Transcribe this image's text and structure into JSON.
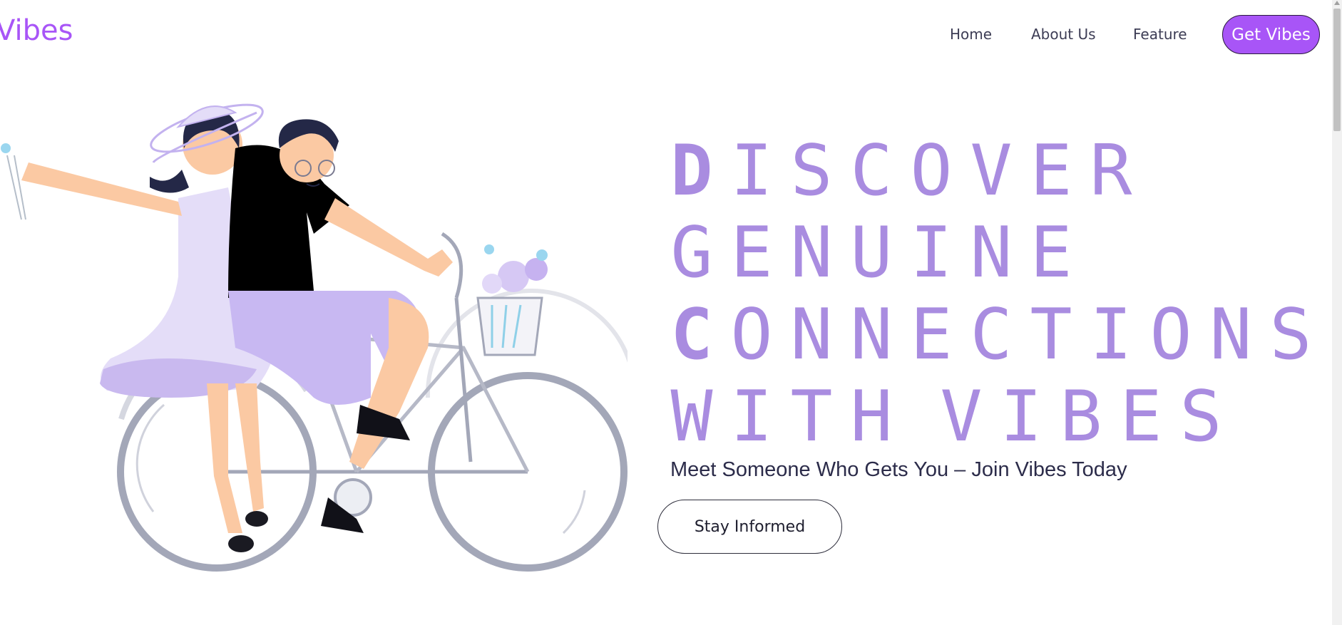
{
  "brand": {
    "logo_text": "Vibes",
    "accent_color": "#a855f7"
  },
  "nav": {
    "items": [
      {
        "label": "Home"
      },
      {
        "label": "About Us"
      },
      {
        "label": "Feature"
      }
    ],
    "cta_label": "Get Vibes"
  },
  "hero": {
    "headline_lines": [
      "DISCOVER",
      "GENUINE",
      "CONNECTIONS",
      "WITH VIBES"
    ],
    "headline_color": "#a98ce0",
    "tagline": "Meet Someone Who Gets You – Join Vibes Today",
    "secondary_button": "Stay Informed",
    "illustration_icon": "couple-on-bicycle-illustration"
  }
}
